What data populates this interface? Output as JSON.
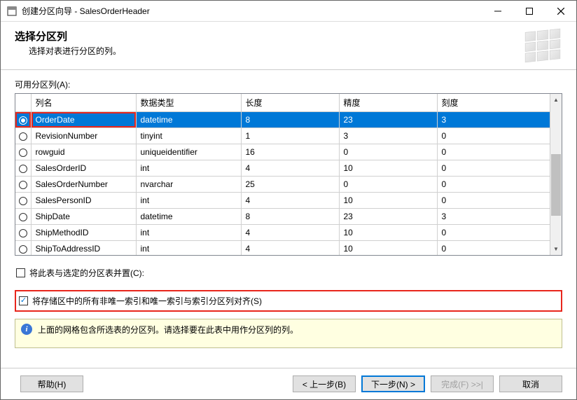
{
  "window": {
    "title": "创建分区向导 - SalesOrderHeader"
  },
  "header": {
    "title": "选择分区列",
    "subtitle": "选择对表进行分区的列。"
  },
  "columnsLabel": "可用分区列(A):",
  "table": {
    "headers": {
      "name": "列名",
      "type": "数据类型",
      "length": "长度",
      "precision": "精度",
      "scale": "刻度"
    },
    "rows": [
      {
        "selected": true,
        "name": "OrderDate",
        "type": "datetime",
        "length": "8",
        "precision": "23",
        "scale": "3",
        "highlight": true
      },
      {
        "selected": false,
        "name": "RevisionNumber",
        "type": "tinyint",
        "length": "1",
        "precision": "3",
        "scale": "0"
      },
      {
        "selected": false,
        "name": "rowguid",
        "type": "uniqueidentifier",
        "length": "16",
        "precision": "0",
        "scale": "0"
      },
      {
        "selected": false,
        "name": "SalesOrderID",
        "type": "int",
        "length": "4",
        "precision": "10",
        "scale": "0"
      },
      {
        "selected": false,
        "name": "SalesOrderNumber",
        "type": "nvarchar",
        "length": "25",
        "precision": "0",
        "scale": "0"
      },
      {
        "selected": false,
        "name": "SalesPersonID",
        "type": "int",
        "length": "4",
        "precision": "10",
        "scale": "0"
      },
      {
        "selected": false,
        "name": "ShipDate",
        "type": "datetime",
        "length": "8",
        "precision": "23",
        "scale": "3"
      },
      {
        "selected": false,
        "name": "ShipMethodID",
        "type": "int",
        "length": "4",
        "precision": "10",
        "scale": "0"
      },
      {
        "selected": false,
        "name": "ShipToAddressID",
        "type": "int",
        "length": "4",
        "precision": "10",
        "scale": "0"
      }
    ]
  },
  "checkboxes": {
    "colocate": {
      "checked": false,
      "label": "将此表与选定的分区表并置(C):"
    },
    "align": {
      "checked": true,
      "label": "将存储区中的所有非唯一索引和唯一索引与索引分区列对齐(S)"
    }
  },
  "info": "上面的网格包含所选表的分区列。请选择要在此表中用作分区列的列。",
  "footer": {
    "help": "帮助(H)",
    "back": "< 上一步(B)",
    "next": "下一步(N) >",
    "finish": "完成(F) >>|",
    "cancel": "取消"
  }
}
